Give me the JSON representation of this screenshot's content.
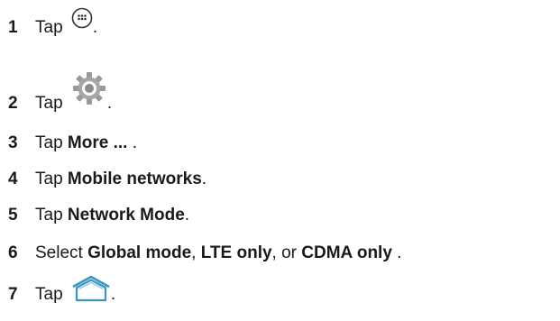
{
  "steps": [
    {
      "number": "1",
      "parts": [
        "Tap ",
        "."
      ],
      "icon": "apps-icon"
    },
    {
      "number": "2",
      "parts": [
        "Tap ",
        "."
      ],
      "icon": "settings-gear-icon"
    },
    {
      "number": "3",
      "parts": [
        "Tap ",
        "More ...",
        " ."
      ]
    },
    {
      "number": "4",
      "parts": [
        "Tap ",
        "Mobile networks",
        "."
      ]
    },
    {
      "number": "5",
      "parts": [
        "Tap ",
        "Network Mode",
        "."
      ]
    },
    {
      "number": "6",
      "parts": [
        "Select ",
        "Global mode",
        ", ",
        "LTE only",
        ", or ",
        "CDMA only",
        " ."
      ]
    },
    {
      "number": "7",
      "parts": [
        "Tap ",
        "."
      ],
      "icon": "home-icon"
    }
  ]
}
